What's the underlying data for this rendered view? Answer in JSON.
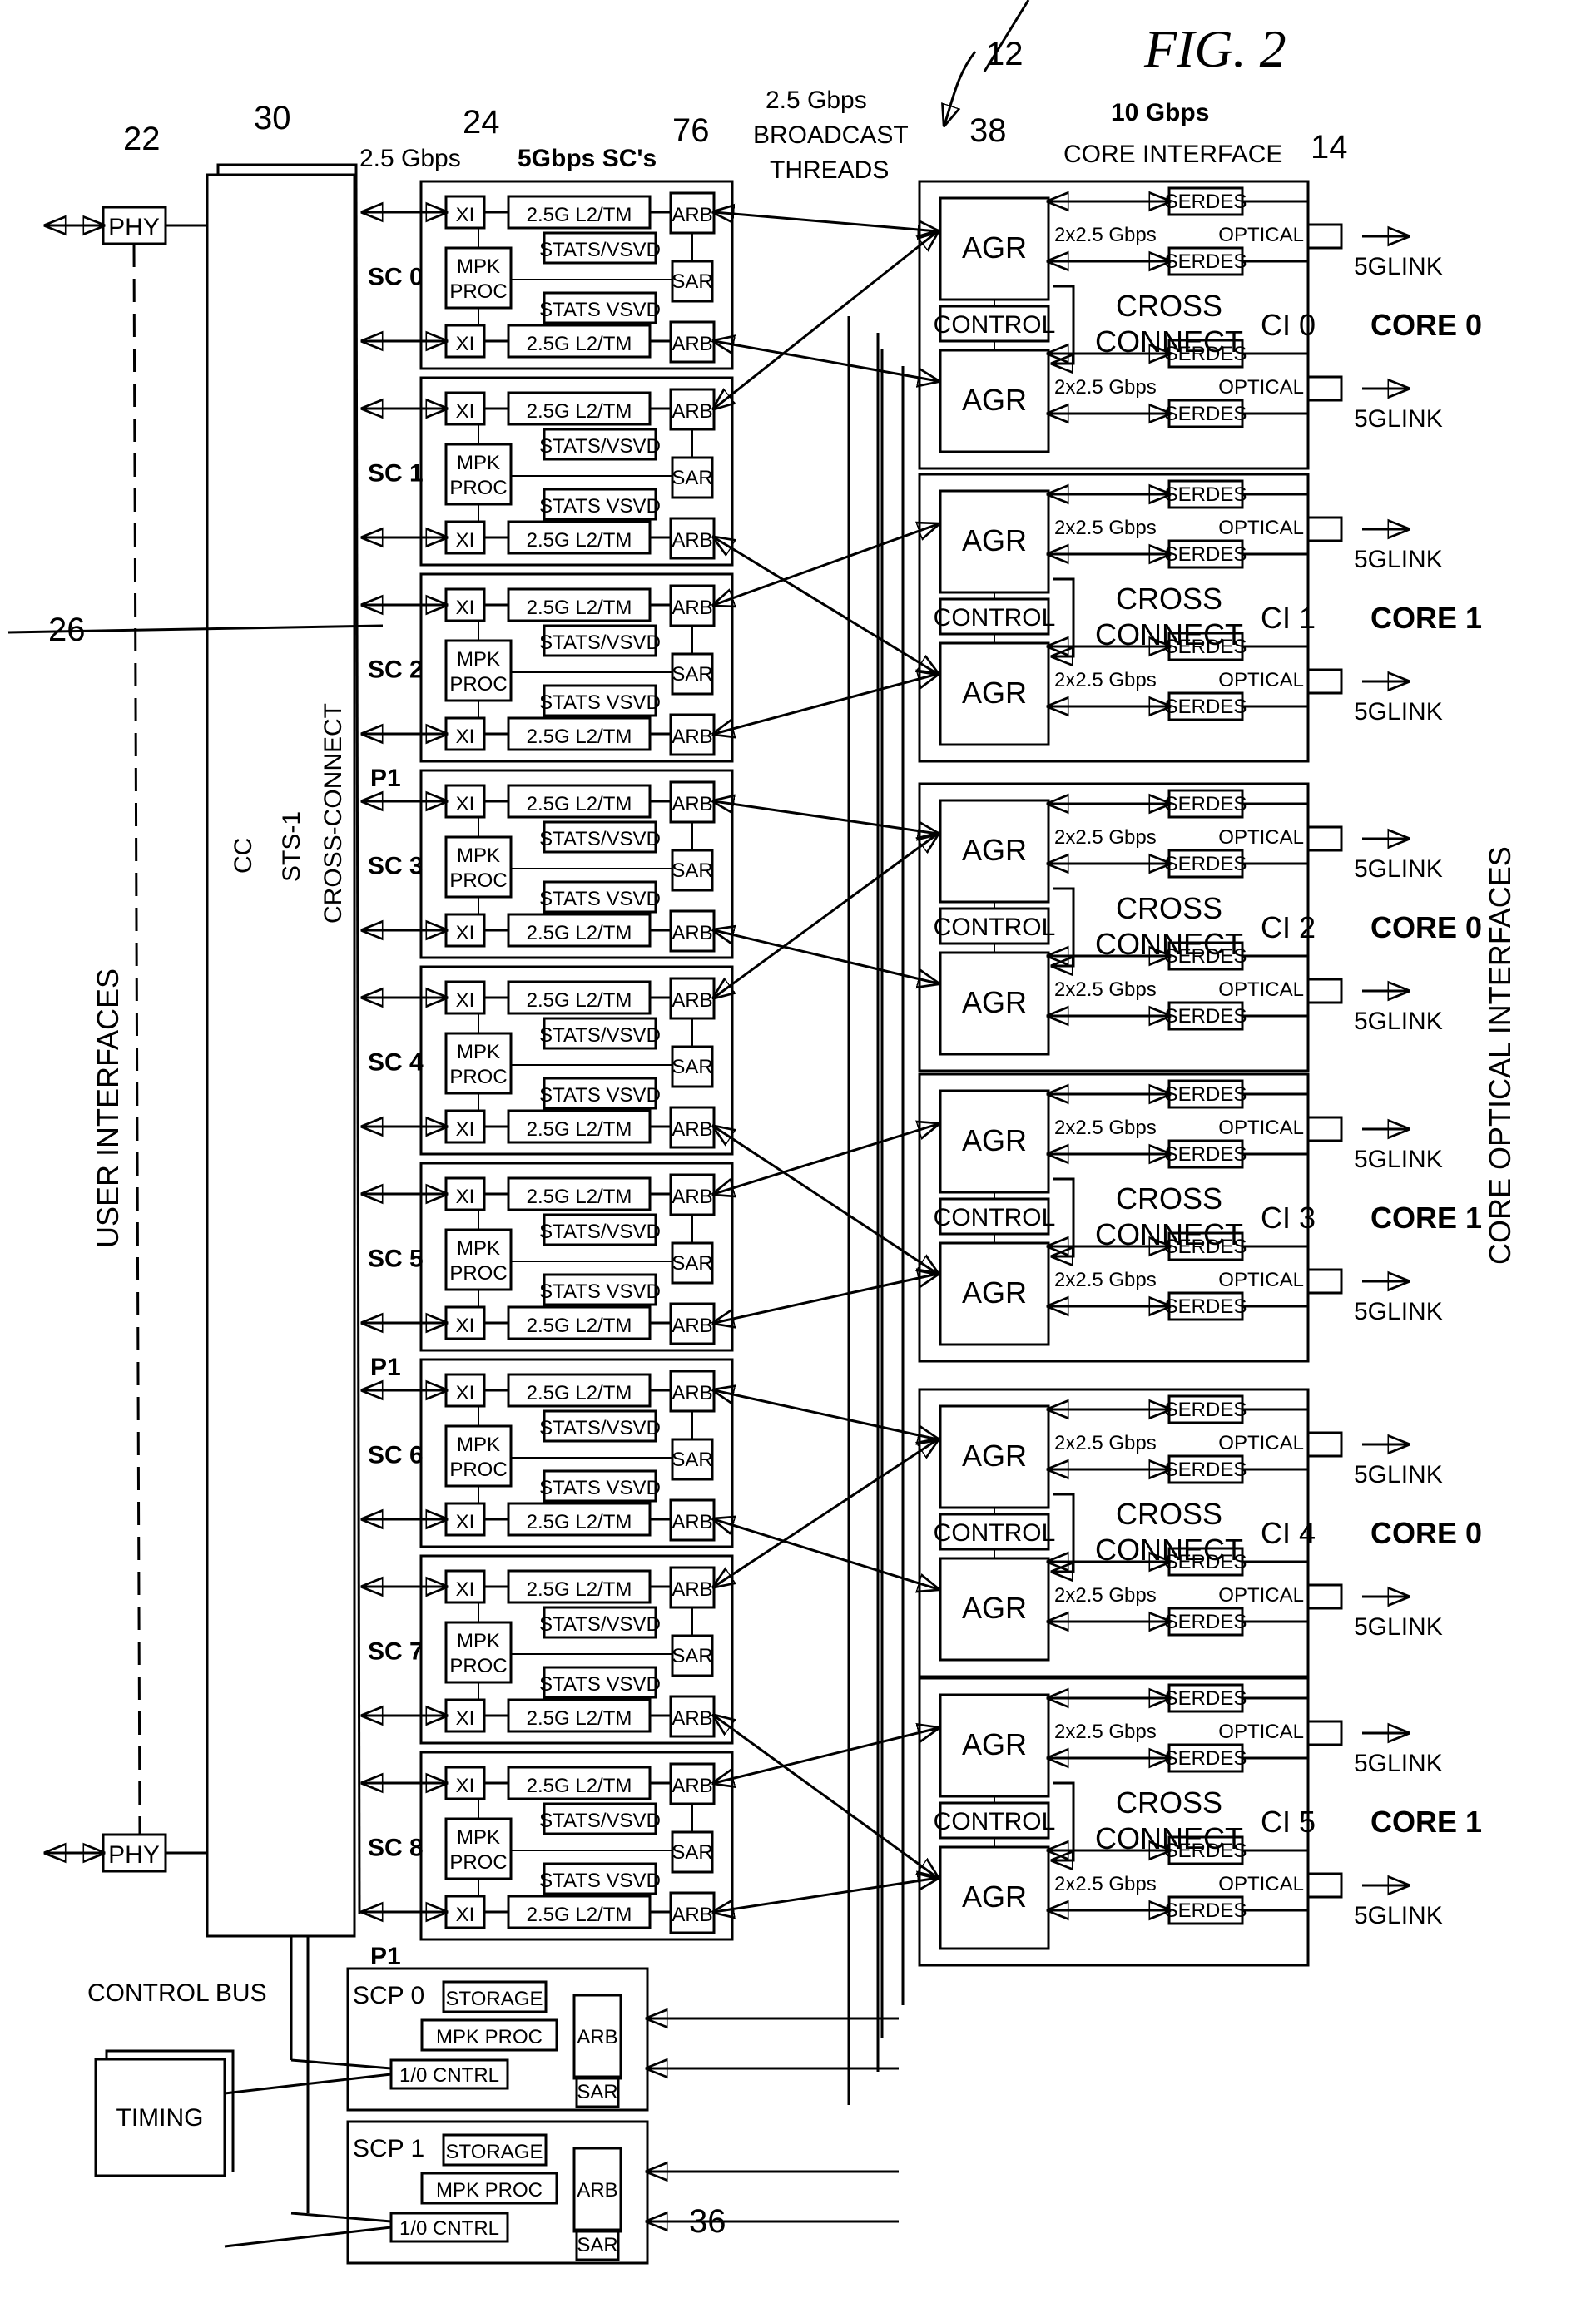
{
  "figure": {
    "title": "FIG. 2",
    "system_ref": "12"
  },
  "refs": {
    "phy": "22",
    "cc": "30",
    "sc": "24",
    "arb": "76",
    "agr": "38",
    "ci": "14",
    "bus": "26",
    "scp": "36"
  },
  "headers": {
    "left_rate": "2.5 Gbps",
    "sc_title": "5Gbps SC's",
    "threads": [
      "2.5 Gbps",
      "BROADCAST",
      "THREADS"
    ],
    "core_rate": "10 Gbps",
    "core_title": "CORE INTERFACE"
  },
  "side_labels": {
    "user": "USER INTERFACES",
    "core": "CORE OPTICAL INTERFACES",
    "control_bus": "CONTROL BUS",
    "cc_lines": [
      "CC",
      "STS-1",
      "CROSS-CONNECT"
    ]
  },
  "phy_label": "PHY",
  "timing_label": "TIMING",
  "sc_parts": {
    "xi": "XI",
    "l2tm": "2.5G L2/TM",
    "stats_top": "STATS/VSVD",
    "stats_bottom": "STATS VSVD",
    "mpk": [
      "MPK",
      "PROC"
    ],
    "arb": "ARB",
    "sar": "SAR"
  },
  "sc_cards": [
    {
      "label": "SC 0"
    },
    {
      "label": "SC 1"
    },
    {
      "label": "SC 2",
      "after": "P1"
    },
    {
      "label": "SC 3"
    },
    {
      "label": "SC 4"
    },
    {
      "label": "SC 5",
      "after": "P1"
    },
    {
      "label": "SC 6"
    },
    {
      "label": "SC 7"
    },
    {
      "label": "SC 8",
      "after": "P1"
    }
  ],
  "ci_parts": {
    "agr": "AGR",
    "control": "CONTROL",
    "serdes": "SERDES",
    "rate": "2x2.5 Gbps",
    "optical": "OPTICAL",
    "cross": [
      "CROSS",
      "CONNECT"
    ],
    "link": "5GLINK"
  },
  "ci_cards": [
    {
      "label": "CI 0",
      "core": "CORE 0"
    },
    {
      "label": "CI 1",
      "core": "CORE 1"
    },
    {
      "label": "CI 2",
      "core": "CORE 0"
    },
    {
      "label": "CI 3",
      "core": "CORE 1"
    },
    {
      "label": "CI 4",
      "core": "CORE 0"
    },
    {
      "label": "CI 5",
      "core": "CORE 1"
    }
  ],
  "scp_parts": {
    "storage": "STORAGE",
    "mpk": "MPK PROC",
    "io": "1/0 CNTRL",
    "arb": "ARB",
    "sar": "SAR"
  },
  "scp_cards": [
    {
      "label": "SCP 0"
    },
    {
      "label": "SCP 1"
    }
  ]
}
